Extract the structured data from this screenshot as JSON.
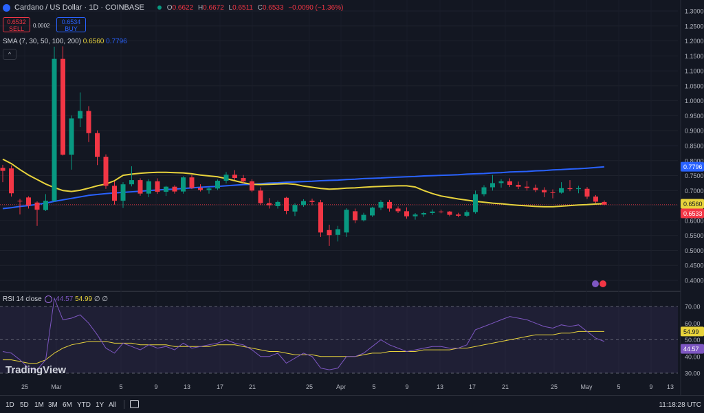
{
  "header": {
    "symbol_title": "Cardano / US Dollar · 1D · COINBASE",
    "ohlc": {
      "o_label": "O",
      "o": "0.6622",
      "h_label": "H",
      "h": "0.6672",
      "l_label": "L",
      "l": "0.6511",
      "c_label": "C",
      "c": "0.6533",
      "change": "−0.0090 (−1.36%)"
    },
    "sell_price": "0.6532",
    "sell_label": "SELL",
    "spread": "0.0002",
    "buy_price": "0.6534",
    "buy_label": "BUY",
    "sma_label": "SMA (7, 30, 50, 100, 200)",
    "sma_val1": "0.6560",
    "sma_val2": "0.7796",
    "collapse_glyph": "^"
  },
  "rsi_header": {
    "label": "RSI 14 close",
    "rsi_val": "44.57",
    "ma_val": "54.99",
    "tail": "∅ ∅"
  },
  "brand": "TradingView",
  "timeframes": [
    "1D",
    "5D",
    "1M",
    "3M",
    "6M",
    "YTD",
    "1Y",
    "All"
  ],
  "clock": "11:18:28 UTC",
  "colors": {
    "up": "#089981",
    "down": "#f23645",
    "sma_fast": "#e8d33c",
    "sma_slow": "#2962ff",
    "rsi": "#7e57c2",
    "rsi_ma": "#e8d33c",
    "bg": "#131722"
  },
  "chart_data": {
    "type": "candlestick",
    "price_axis": {
      "min": 0.36,
      "max": 1.32,
      "ticks": [
        "1.3000",
        "1.2500",
        "1.2000",
        "1.1500",
        "1.1000",
        "1.0500",
        "1.0000",
        "0.9500",
        "0.9000",
        "0.8500",
        "0.8000",
        "0.7500",
        "0.7000",
        "0.6500",
        "0.6000",
        "0.5500",
        "0.5000",
        "0.4500",
        "0.4000"
      ]
    },
    "price_labels": [
      {
        "value": 0.7796,
        "text": "0.7796",
        "color": "#2962ff"
      },
      {
        "value": 0.656,
        "text": "0.6560",
        "color": "#e8d33c"
      },
      {
        "value": 0.6533,
        "text": "0.6533",
        "color": "#f23645"
      }
    ],
    "x_labels": [
      "25",
      "Mar",
      "5",
      "9",
      "13",
      "17",
      "21",
      "25",
      "Apr",
      "5",
      "9",
      "13",
      "17",
      "21",
      "25",
      "May",
      "5",
      "9",
      "13"
    ],
    "candles": [
      {
        "o": 0.776,
        "h": 0.786,
        "l": 0.728,
        "c": 0.766
      },
      {
        "o": 0.774,
        "h": 0.784,
        "l": 0.68,
        "c": 0.691
      },
      {
        "o": 0.666,
        "h": 0.672,
        "l": 0.62,
        "c": 0.665
      },
      {
        "o": 0.677,
        "h": 0.681,
        "l": 0.64,
        "c": 0.65
      },
      {
        "o": 0.66,
        "h": 0.664,
        "l": 0.582,
        "c": 0.636
      },
      {
        "o": 0.635,
        "h": 0.688,
        "l": 0.632,
        "c": 0.666
      },
      {
        "o": 0.666,
        "h": 1.181,
        "l": 0.662,
        "c": 1.14
      },
      {
        "o": 1.14,
        "h": 1.182,
        "l": 0.817,
        "c": 0.82
      },
      {
        "o": 0.82,
        "h": 0.951,
        "l": 0.77,
        "c": 0.941
      },
      {
        "o": 0.941,
        "h": 1.028,
        "l": 0.912,
        "c": 0.966
      },
      {
        "o": 0.966,
        "h": 0.982,
        "l": 0.862,
        "c": 0.892
      },
      {
        "o": 0.892,
        "h": 0.901,
        "l": 0.785,
        "c": 0.813
      },
      {
        "o": 0.813,
        "h": 0.821,
        "l": 0.706,
        "c": 0.716
      },
      {
        "o": 0.716,
        "h": 0.731,
        "l": 0.653,
        "c": 0.666
      },
      {
        "o": 0.666,
        "h": 0.728,
        "l": 0.642,
        "c": 0.721
      },
      {
        "o": 0.721,
        "h": 0.781,
        "l": 0.714,
        "c": 0.735
      },
      {
        "o": 0.735,
        "h": 0.741,
        "l": 0.683,
        "c": 0.69
      },
      {
        "o": 0.69,
        "h": 0.738,
        "l": 0.678,
        "c": 0.731
      },
      {
        "o": 0.731,
        "h": 0.741,
        "l": 0.689,
        "c": 0.696
      },
      {
        "o": 0.696,
        "h": 0.716,
        "l": 0.682,
        "c": 0.713
      },
      {
        "o": 0.713,
        "h": 0.718,
        "l": 0.69,
        "c": 0.697
      },
      {
        "o": 0.697,
        "h": 0.748,
        "l": 0.69,
        "c": 0.744
      },
      {
        "o": 0.744,
        "h": 0.752,
        "l": 0.705,
        "c": 0.709
      },
      {
        "o": 0.709,
        "h": 0.721,
        "l": 0.697,
        "c": 0.702
      },
      {
        "o": 0.702,
        "h": 0.712,
        "l": 0.69,
        "c": 0.707
      },
      {
        "o": 0.707,
        "h": 0.737,
        "l": 0.702,
        "c": 0.733
      },
      {
        "o": 0.733,
        "h": 0.762,
        "l": 0.724,
        "c": 0.753
      },
      {
        "o": 0.753,
        "h": 0.768,
        "l": 0.735,
        "c": 0.742
      },
      {
        "o": 0.742,
        "h": 0.752,
        "l": 0.725,
        "c": 0.731
      },
      {
        "o": 0.731,
        "h": 0.738,
        "l": 0.695,
        "c": 0.7
      },
      {
        "o": 0.7,
        "h": 0.711,
        "l": 0.652,
        "c": 0.658
      },
      {
        "o": 0.658,
        "h": 0.675,
        "l": 0.64,
        "c": 0.651
      },
      {
        "o": 0.648,
        "h": 0.667,
        "l": 0.64,
        "c": 0.662
      },
      {
        "o": 0.676,
        "h": 0.679,
        "l": 0.621,
        "c": 0.632
      },
      {
        "o": 0.63,
        "h": 0.657,
        "l": 0.615,
        "c": 0.652
      },
      {
        "o": 0.652,
        "h": 0.671,
        "l": 0.646,
        "c": 0.665
      },
      {
        "o": 0.666,
        "h": 0.673,
        "l": 0.651,
        "c": 0.662
      },
      {
        "o": 0.661,
        "h": 0.669,
        "l": 0.545,
        "c": 0.56
      },
      {
        "o": 0.568,
        "h": 0.586,
        "l": 0.515,
        "c": 0.551
      },
      {
        "o": 0.552,
        "h": 0.582,
        "l": 0.53,
        "c": 0.571
      },
      {
        "o": 0.56,
        "h": 0.641,
        "l": 0.545,
        "c": 0.636
      },
      {
        "o": 0.631,
        "h": 0.64,
        "l": 0.591,
        "c": 0.601
      },
      {
        "o": 0.601,
        "h": 0.626,
        "l": 0.597,
        "c": 0.619
      },
      {
        "o": 0.617,
        "h": 0.646,
        "l": 0.612,
        "c": 0.643
      },
      {
        "o": 0.643,
        "h": 0.668,
        "l": 0.635,
        "c": 0.662
      },
      {
        "o": 0.662,
        "h": 0.669,
        "l": 0.63,
        "c": 0.64
      },
      {
        "o": 0.64,
        "h": 0.647,
        "l": 0.625,
        "c": 0.631
      },
      {
        "o": 0.631,
        "h": 0.644,
        "l": 0.606,
        "c": 0.614
      },
      {
        "o": 0.614,
        "h": 0.625,
        "l": 0.603,
        "c": 0.62
      },
      {
        "o": 0.62,
        "h": 0.629,
        "l": 0.612,
        "c": 0.625
      },
      {
        "o": 0.625,
        "h": 0.637,
        "l": 0.619,
        "c": 0.63
      },
      {
        "o": 0.63,
        "h": 0.636,
        "l": 0.624,
        "c": 0.628
      },
      {
        "o": 0.63,
        "h": 0.632,
        "l": 0.614,
        "c": 0.619
      },
      {
        "o": 0.62,
        "h": 0.626,
        "l": 0.611,
        "c": 0.616
      },
      {
        "o": 0.616,
        "h": 0.634,
        "l": 0.612,
        "c": 0.628
      },
      {
        "o": 0.628,
        "h": 0.7,
        "l": 0.623,
        "c": 0.688
      },
      {
        "o": 0.688,
        "h": 0.718,
        "l": 0.681,
        "c": 0.711
      },
      {
        "o": 0.711,
        "h": 0.752,
        "l": 0.7,
        "c": 0.725
      },
      {
        "o": 0.725,
        "h": 0.738,
        "l": 0.71,
        "c": 0.731
      },
      {
        "o": 0.731,
        "h": 0.741,
        "l": 0.712,
        "c": 0.719
      },
      {
        "o": 0.719,
        "h": 0.73,
        "l": 0.705,
        "c": 0.713
      },
      {
        "o": 0.713,
        "h": 0.732,
        "l": 0.7,
        "c": 0.709
      },
      {
        "o": 0.709,
        "h": 0.72,
        "l": 0.695,
        "c": 0.702
      },
      {
        "o": 0.702,
        "h": 0.711,
        "l": 0.678,
        "c": 0.694
      },
      {
        "o": 0.694,
        "h": 0.704,
        "l": 0.674,
        "c": 0.693
      },
      {
        "o": 0.693,
        "h": 0.728,
        "l": 0.69,
        "c": 0.708
      },
      {
        "o": 0.708,
        "h": 0.735,
        "l": 0.698,
        "c": 0.705
      },
      {
        "o": 0.705,
        "h": 0.716,
        "l": 0.691,
        "c": 0.708
      },
      {
        "o": 0.706,
        "h": 0.712,
        "l": 0.672,
        "c": 0.68
      },
      {
        "o": 0.68,
        "h": 0.685,
        "l": 0.658,
        "c": 0.663
      },
      {
        "o": 0.662,
        "h": 0.667,
        "l": 0.651,
        "c": 0.653
      }
    ],
    "sma_fast": [
      0.805,
      0.79,
      0.77,
      0.752,
      0.737,
      0.722,
      0.71,
      0.7,
      0.697,
      0.701,
      0.708,
      0.716,
      0.722,
      0.733,
      0.751,
      0.755,
      0.758,
      0.76,
      0.761,
      0.761,
      0.76,
      0.759,
      0.756,
      0.752,
      0.749,
      0.746,
      0.74,
      0.733,
      0.726,
      0.721,
      0.72,
      0.721,
      0.722,
      0.723,
      0.721,
      0.715,
      0.711,
      0.707,
      0.705,
      0.706,
      0.708,
      0.709,
      0.711,
      0.713,
      0.714,
      0.715,
      0.716,
      0.716,
      0.712,
      0.7,
      0.69,
      0.682,
      0.677,
      0.672,
      0.668,
      0.664,
      0.661,
      0.658,
      0.656,
      0.653,
      0.651,
      0.649,
      0.647,
      0.646,
      0.646,
      0.648,
      0.65,
      0.652,
      0.653,
      0.655,
      0.656
    ],
    "sma_slow": [
      0.64,
      0.643,
      0.647,
      0.65,
      0.654,
      0.658,
      0.664,
      0.669,
      0.674,
      0.679,
      0.684,
      0.687,
      0.69,
      0.692,
      0.694,
      0.696,
      0.698,
      0.7,
      0.702,
      0.704,
      0.705,
      0.707,
      0.709,
      0.711,
      0.713,
      0.714,
      0.716,
      0.718,
      0.72,
      0.721,
      0.723,
      0.725,
      0.726,
      0.728,
      0.729,
      0.73,
      0.731,
      0.733,
      0.734,
      0.735,
      0.737,
      0.738,
      0.74,
      0.741,
      0.742,
      0.744,
      0.745,
      0.746,
      0.747,
      0.749,
      0.75,
      0.751,
      0.752,
      0.753,
      0.755,
      0.756,
      0.757,
      0.759,
      0.76,
      0.762,
      0.763,
      0.764,
      0.766,
      0.767,
      0.769,
      0.77,
      0.772,
      0.773,
      0.775,
      0.777,
      0.7796
    ],
    "rsi_axis": {
      "min": 25,
      "max": 75,
      "ticks": [
        "70.00",
        "60.00",
        "50.00",
        "40.00",
        "30.00"
      ],
      "band": [
        30,
        70
      ],
      "midline": 50
    },
    "rsi_labels": [
      {
        "value": 54.99,
        "text": "54.99",
        "color": "#e8d33c"
      },
      {
        "value": 44.57,
        "text": "44.57",
        "color": "#7e57c2"
      }
    ],
    "rsi": [
      43,
      42,
      38,
      33,
      32,
      38,
      75,
      62,
      63,
      65,
      60,
      53,
      45,
      42,
      48,
      46,
      44,
      47,
      45,
      46,
      44,
      48,
      45,
      46,
      47,
      48,
      50,
      48,
      47,
      44,
      40,
      40,
      42,
      36,
      39,
      42,
      40,
      33,
      32,
      33,
      40,
      40,
      42,
      46,
      50,
      47,
      45,
      43,
      44,
      45,
      46,
      46,
      45,
      45,
      47,
      56,
      58,
      60,
      62,
      64,
      63,
      62,
      60,
      58,
      57,
      59,
      58,
      59,
      55,
      51,
      49
    ],
    "rsi_ma": [
      38,
      38,
      37,
      36,
      36,
      38,
      42,
      45,
      47,
      48,
      49,
      49,
      49,
      48,
      48,
      48,
      47,
      47,
      47,
      47,
      46,
      46,
      46,
      46,
      46,
      47,
      47,
      47,
      46,
      45,
      44,
      43,
      43,
      42,
      41,
      41,
      41,
      40,
      40,
      40,
      40,
      40,
      41,
      42,
      42,
      43,
      43,
      43,
      43,
      44,
      44,
      44,
      44,
      45,
      45,
      46,
      47,
      48,
      49,
      50,
      51,
      52,
      53,
      53,
      53,
      54,
      54,
      55,
      55,
      55,
      54.99
    ]
  }
}
